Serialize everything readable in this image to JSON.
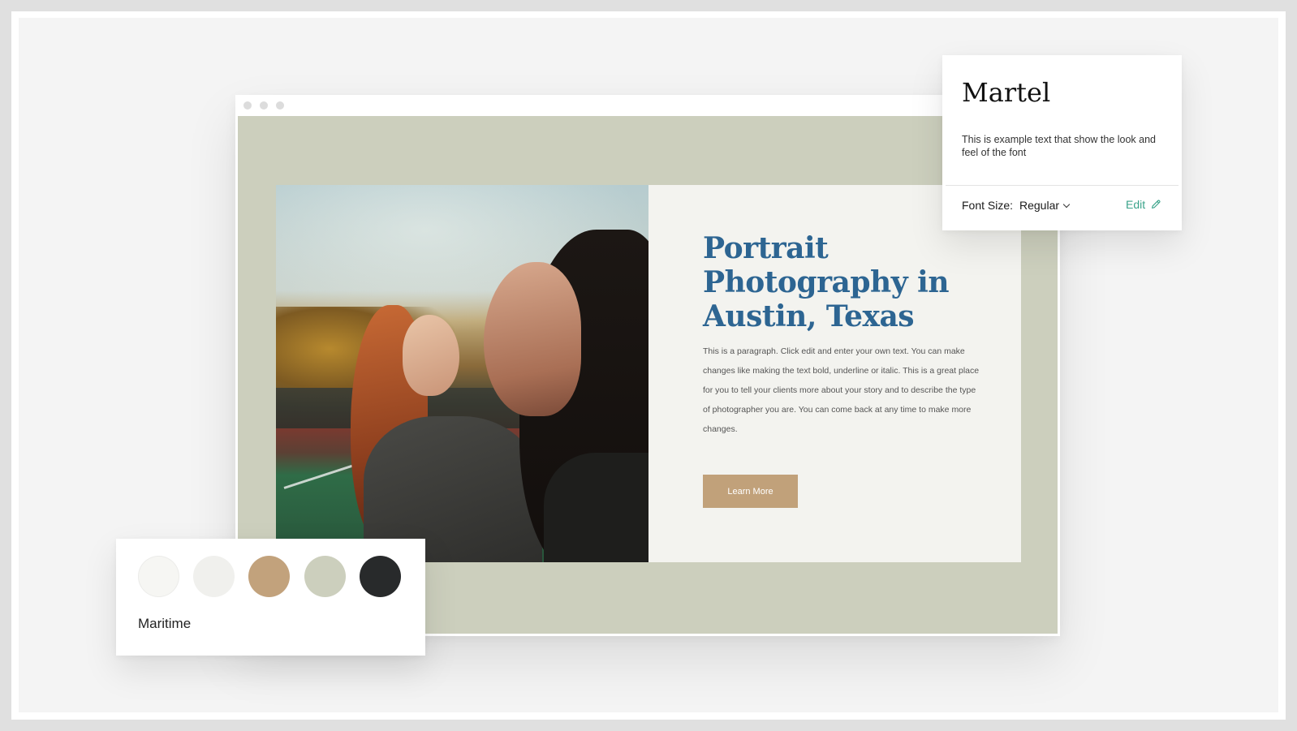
{
  "browser": {
    "hero": {
      "title": "Portrait Photography in Austin, Texas",
      "paragraph": "This is a paragraph. Click edit and enter your own text. You can make changes like making the text bold, underline or italic. This is a great place for you to tell your clients more about your story and to describe the type of photographer you are. You can come back at any time to make more changes.",
      "button_label": "Learn More",
      "title_color": "#2d6592",
      "button_color": "#c1a17a",
      "background_color": "#cccfbd"
    }
  },
  "font_card": {
    "font_name": "Martel",
    "sample_text": "This is example text that show the look and feel of the font",
    "size_label": "Font Size:",
    "size_value": "Regular",
    "edit_label": "Edit",
    "edit_color": "#3aa38a",
    "icons": [
      "chevron-down-icon",
      "pencil-icon"
    ]
  },
  "palette_card": {
    "name": "Maritime",
    "swatches": [
      "#f6f6f3",
      "#f0f0ed",
      "#c2a27c",
      "#cccfbd",
      "#282a2b"
    ]
  }
}
